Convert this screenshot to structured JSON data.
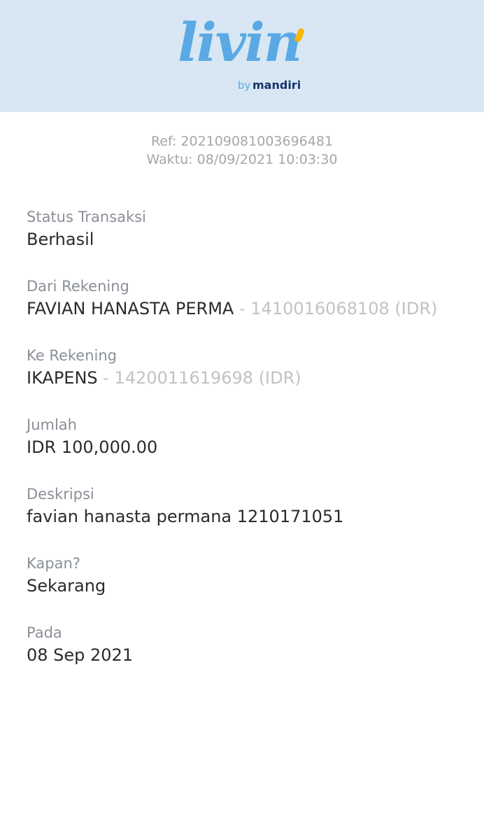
{
  "header": {
    "logo_word": "livin",
    "logo_by": "by",
    "logo_brand": "mandiri"
  },
  "meta": {
    "ref": "Ref: 202109081003696481",
    "time": "Waktu: 08/09/2021 10:03:30"
  },
  "fields": {
    "status": {
      "label": "Status Transaksi",
      "value": "Berhasil"
    },
    "from": {
      "label": "Dari Rekening",
      "name": "FAVIAN HANASTA PERMA",
      "account": " - 1410016068108 (IDR)"
    },
    "to": {
      "label": "Ke Rekening",
      "name": "IKAPENS",
      "account": " - 1420011619698 (IDR)"
    },
    "amount": {
      "label": "Jumlah",
      "value": "IDR 100,000.00"
    },
    "description": {
      "label": "Deskripsi",
      "value": "favian hanasta permana 1210171051"
    },
    "when": {
      "label": "Kapan?",
      "value": "Sekarang"
    },
    "date": {
      "label": "Pada",
      "value": "08 Sep 2021"
    }
  },
  "colors": {
    "header_bg": "#d8e7f3",
    "logo_blue": "#5aa9e4",
    "logo_navy": "#16356a",
    "logo_accent": "#f8b800"
  }
}
